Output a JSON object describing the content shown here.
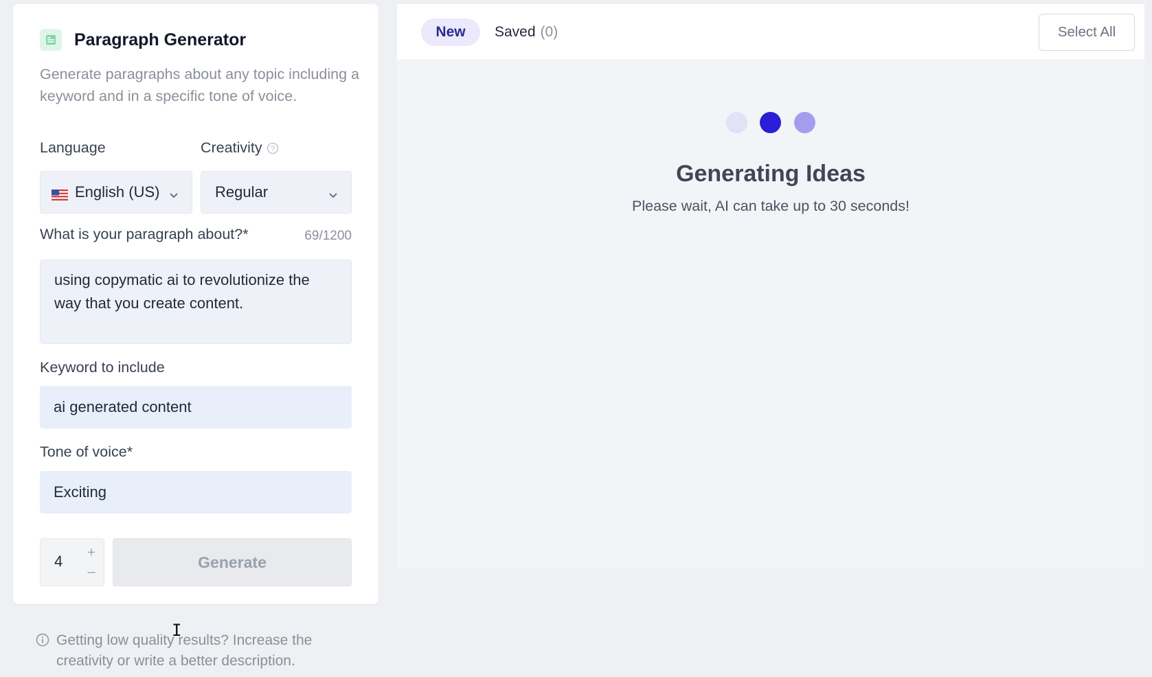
{
  "generator": {
    "title": "Paragraph Generator",
    "description": "Generate paragraphs about any topic including a keyword and in a specific tone of voice.",
    "icon": "document-lines-icon"
  },
  "form": {
    "language": {
      "label": "Language",
      "value": "English (US)",
      "flag_icon": "us-flag-icon"
    },
    "creativity": {
      "label": "Creativity",
      "value": "Regular",
      "help_icon": "question-circle-icon"
    },
    "about": {
      "label": "What is your paragraph about?*",
      "counter": "69/1200",
      "value": "using copymatic ai to revolutionize the way that you create content."
    },
    "keyword": {
      "label": "Keyword to include",
      "value": "ai generated content"
    },
    "tone": {
      "label": "Tone of voice*",
      "value": "Exciting"
    },
    "quantity": "4",
    "generate_label": "Generate"
  },
  "tip": {
    "text": "Getting low quality results? Increase the creativity or write a better description.",
    "icon": "info-circle-icon"
  },
  "results": {
    "tabs": {
      "new_label": "New",
      "saved_label": "Saved",
      "saved_count": "(0)"
    },
    "select_all_label": "Select All",
    "loading_title": "Generating Ideas",
    "loading_subtitle": "Please wait, AI can take up to 30 seconds!"
  },
  "colors": {
    "accent": "#2a1fd6",
    "dot_light": "#e3e1f5",
    "dot_mid": "#a49ded"
  }
}
